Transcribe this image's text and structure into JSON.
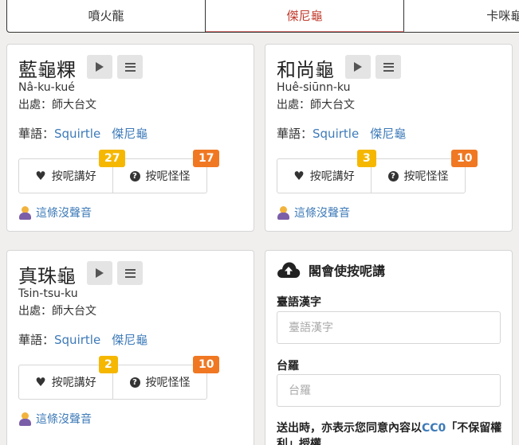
{
  "tabs": [
    {
      "label": "噴火龍"
    },
    {
      "label": "傑尼龜"
    },
    {
      "label": "卡咪龜"
    }
  ],
  "cards": [
    {
      "word": "藍龜粿",
      "romanization": "Nâ-ku-kué",
      "source": "出處：師大台文",
      "mandarin_label": "華語：",
      "mandarin_links": [
        "Squirtle",
        "傑尼龜"
      ],
      "like_label": "按呢講好",
      "like_count": "27",
      "odd_label": "按呢怪怪",
      "odd_count": "17",
      "no_sound": "這條沒聲音"
    },
    {
      "word": "和尚龜",
      "romanization": "Huê-siūnn-ku",
      "source": "出處：師大台文",
      "mandarin_label": "華語：",
      "mandarin_links": [
        "Squirtle",
        "傑尼龜"
      ],
      "like_label": "按呢講好",
      "like_count": "3",
      "odd_label": "按呢怪怪",
      "odd_count": "10",
      "no_sound": "這條沒聲音"
    },
    {
      "word": "真珠龜",
      "romanization": "Tsin-tsu-ku",
      "source": "出處：師大台文",
      "mandarin_label": "華語：",
      "mandarin_links": [
        "Squirtle",
        "傑尼龜"
      ],
      "like_label": "按呢講好",
      "like_count": "2",
      "odd_label": "按呢怪怪",
      "odd_count": "10",
      "no_sound": "這條沒聲音"
    }
  ],
  "submit_form": {
    "title": "閣會使按呢講",
    "hanji_label": "臺語漢字",
    "hanji_placeholder": "臺語漢字",
    "lomaji_label": "台羅",
    "lomaji_placeholder": "台羅",
    "note_prefix": "送出時，亦表示您同意內容以",
    "note_cc": "CC0",
    "note_suffix": "「不保留權利」授權"
  },
  "colors": {
    "active_tab": "#c0392b",
    "link": "#3d7ab8",
    "badge_like": "#f5b700",
    "badge_odd": "#f07822"
  },
  "icons": {
    "play": "play-icon",
    "list": "list-icon",
    "like": "heart-icon",
    "odd": "question-circle-icon",
    "no_sound": "person-raising-hand-icon",
    "upload": "cloud-upload-icon"
  }
}
